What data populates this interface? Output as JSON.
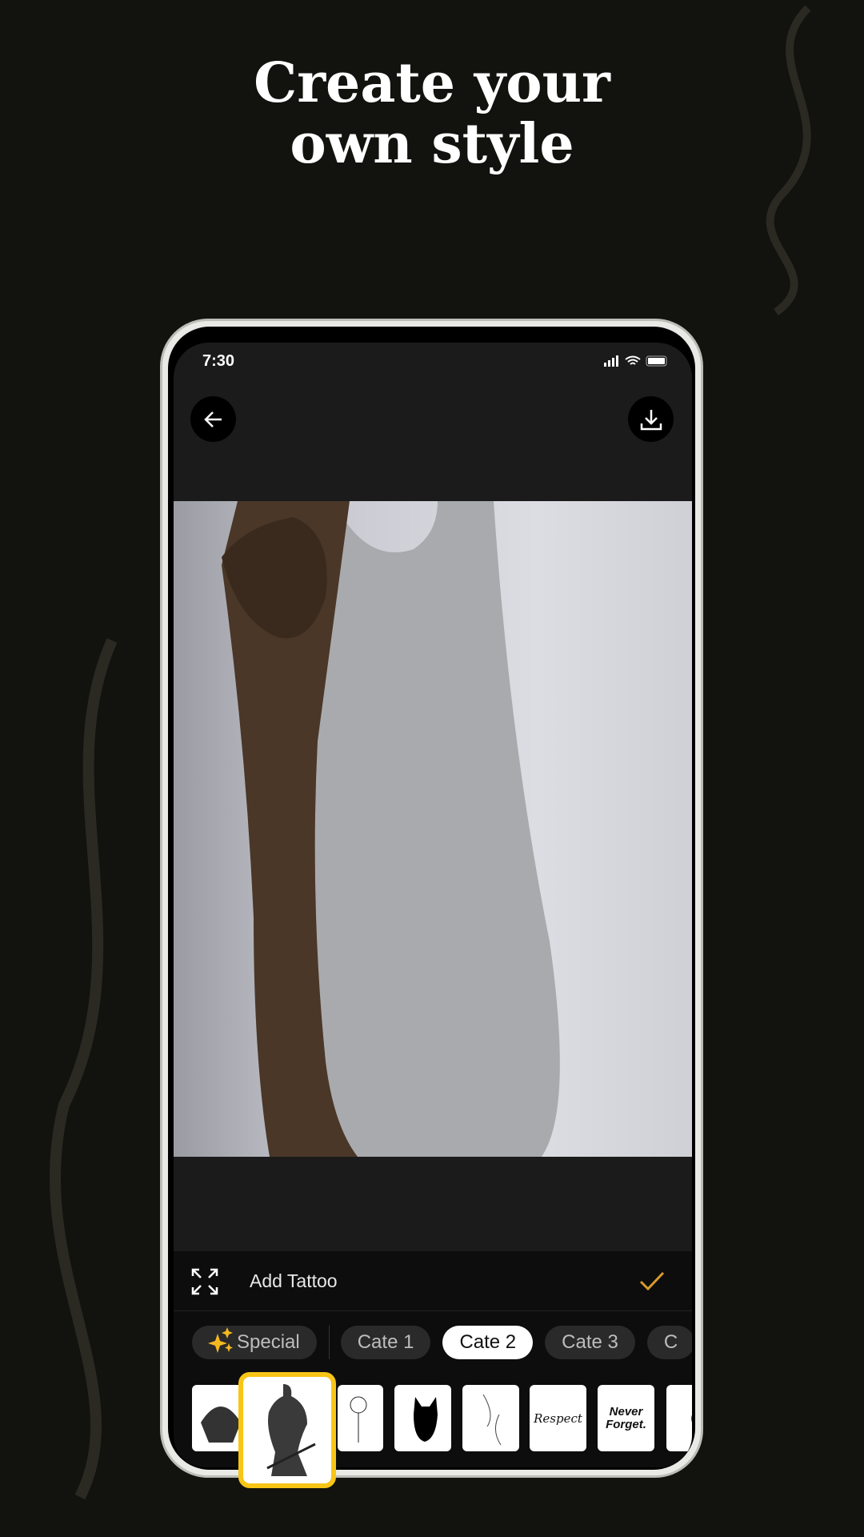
{
  "headline": {
    "line1": "Create your",
    "line2": "own style"
  },
  "status_bar": {
    "time": "7:30"
  },
  "toolbar": {
    "back_icon": "arrow-left-icon",
    "download_icon": "download-icon"
  },
  "panel": {
    "add_label": "Add Tattoo",
    "expand_icon": "expand-icon",
    "confirm_icon": "check-icon",
    "accent": "#d99a2b"
  },
  "categories": [
    {
      "label": "Special",
      "icon": "sparkles-icon"
    },
    {
      "label": "Cate 1"
    },
    {
      "label": "Cate 2",
      "selected": true
    },
    {
      "label": "Cate 3"
    },
    {
      "label": "C"
    }
  ],
  "thumbnails": [
    "Respect",
    "Never Forget."
  ],
  "colors": {
    "background": "#12120e",
    "selection": "#f7c516",
    "sparkle": "#f5b820"
  }
}
